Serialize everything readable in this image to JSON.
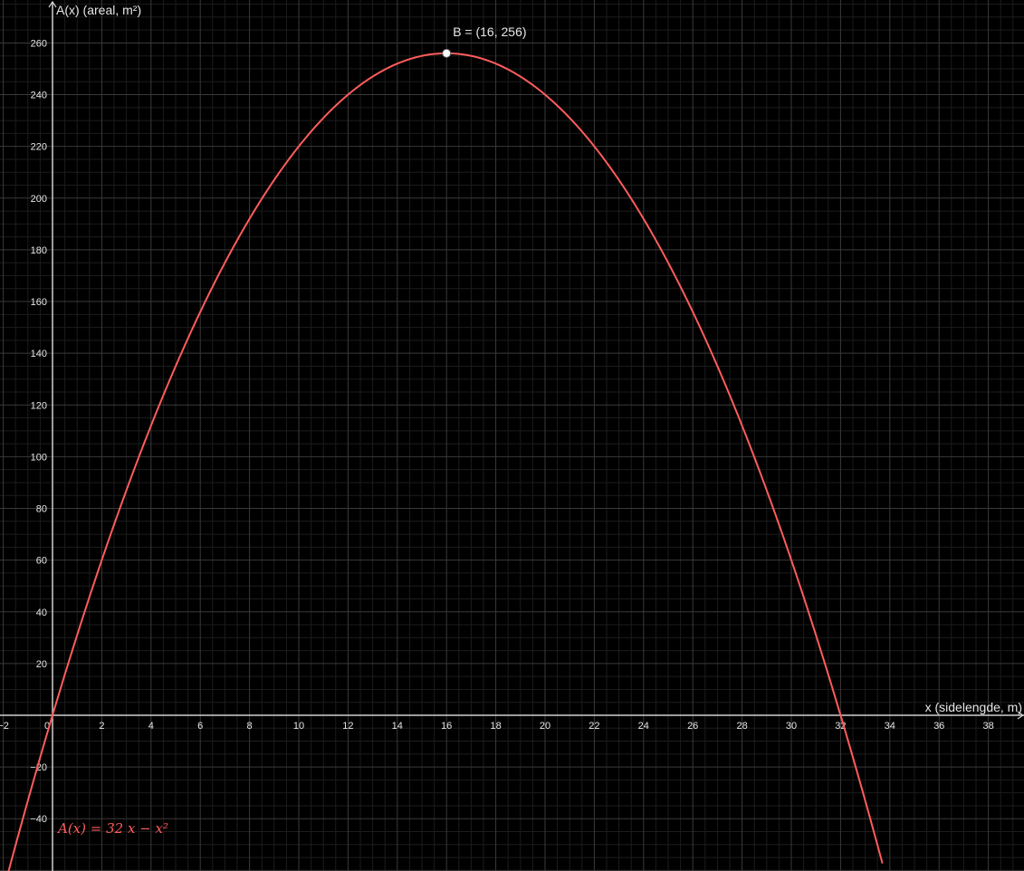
{
  "chart_data": {
    "type": "line",
    "xlabel": "x (sidelengde, m)",
    "ylabel": "A(x) (areal, m²)",
    "xlim": [
      -2.2,
      39.3
    ],
    "ylim": [
      -60,
      275
    ],
    "grid": true,
    "x_ticks": [
      -2,
      0,
      2,
      4,
      6,
      8,
      10,
      12,
      14,
      16,
      18,
      20,
      22,
      24,
      26,
      28,
      30,
      32,
      34,
      36,
      38
    ],
    "y_ticks": [
      -40,
      -20,
      20,
      40,
      60,
      80,
      100,
      120,
      140,
      160,
      180,
      200,
      220,
      240,
      260
    ],
    "series": [
      {
        "label": "A(x) = 32 x − x²",
        "color": "#ff5c5c",
        "coefficients": {
          "a": -1,
          "b": 32,
          "c": 0
        },
        "x": [
          -1.8,
          0,
          2,
          4,
          6,
          8,
          10,
          12,
          14,
          16,
          18,
          20,
          22,
          24,
          26,
          28,
          30,
          32,
          33.7
        ],
        "y": [
          -60.8,
          0,
          60,
          112,
          156,
          192,
          220,
          240,
          252,
          256,
          252,
          240,
          220,
          192,
          156,
          112,
          60,
          0,
          -57.3
        ]
      }
    ],
    "points": [
      {
        "label": "B = (16, 256)",
        "x": 16,
        "y": 256
      }
    ],
    "colors": {
      "background": "#000000",
      "curve": "#ff5c5c",
      "axis": "#cfcfcf",
      "grid_major": "#3a3a3a",
      "grid_minor": "#1c1c1c"
    }
  }
}
